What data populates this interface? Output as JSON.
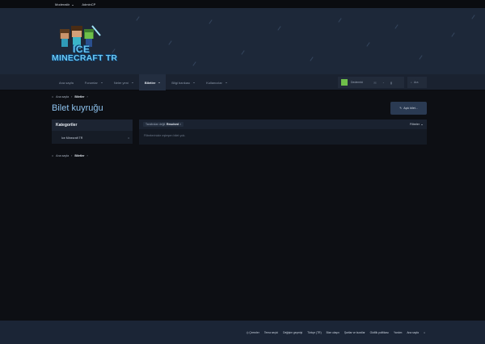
{
  "staffbar": {
    "moderation": "Moderatör",
    "admincp": "AdminCP"
  },
  "logo": {
    "line1": "ICE",
    "line2": "MINECRAFT TR"
  },
  "nav": {
    "items": [
      {
        "label": "Ana sayfa",
        "has_menu": false
      },
      {
        "label": "Forumlar",
        "has_menu": true
      },
      {
        "label": "Neler yeni",
        "has_menu": true
      },
      {
        "label": "Biletler",
        "has_menu": true,
        "active": true
      },
      {
        "label": "Bilgi bankası",
        "has_menu": true
      },
      {
        "label": "Kullanıcılar",
        "has_menu": true
      }
    ],
    "username": "Dedemrki",
    "search": "Ara"
  },
  "breadcrumb": {
    "home": "Ana sayfa",
    "current": "Biletler"
  },
  "page": {
    "title": "Bilet kuyruğu",
    "new_ticket": "Açık bilet..."
  },
  "sidebar": {
    "heading": "Kategoriler",
    "items": [
      {
        "label": "Ice Minecraft TR",
        "count": "0"
      }
    ]
  },
  "main": {
    "filter_prefix": "Tarafından değil:",
    "filter_value": "Resolved",
    "filters_button": "Filtreler",
    "empty_message": "Filtrelerinizle eşleşen bilet yok."
  },
  "footer": {
    "links": [
      "Çerezler",
      "Tema seçici",
      "Değişim geçmişi",
      "Türkçe (TR)",
      "Bize ulaşın",
      "Şartlar ve kurallar",
      "Gizlilik politikası",
      "Yardım",
      "Ana sayfa"
    ]
  },
  "colors": {
    "accent": "#8fc4f0",
    "header": "#1d2839",
    "bg": "#0d0f14"
  }
}
